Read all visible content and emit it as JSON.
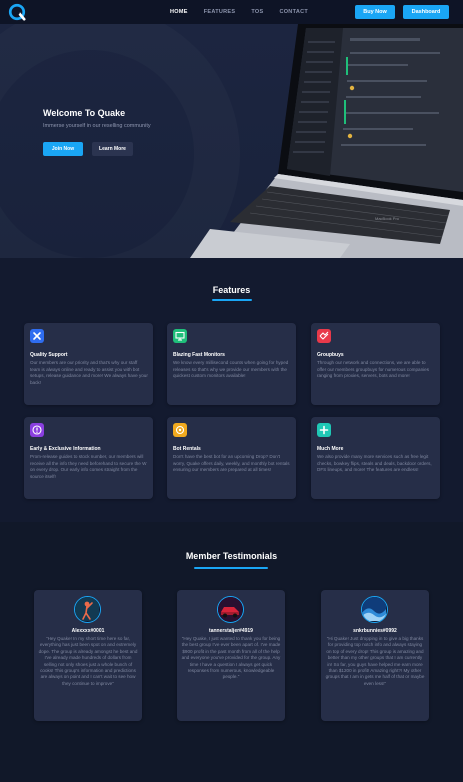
{
  "nav": {
    "links": [
      "HOME",
      "FEATURES",
      "TOS",
      "CONTACT"
    ],
    "buy_label": "Buy Now",
    "dashboard_label": "Dashboard"
  },
  "hero": {
    "title": "Welcome To Quake",
    "subtitle": "Immerse yourself in our reselling community",
    "join_label": "Join Now",
    "learn_label": "Learn More",
    "laptop_brand": "MacBook Pro"
  },
  "features": {
    "title": "Features",
    "cards": [
      {
        "icon": "tools-icon",
        "color": "#2f6df0",
        "title": "Quality Support",
        "text": "Our members are our priority and that's why our staff team is always online and ready to assist you with bot setups, release guidance and more! We always have your back!"
      },
      {
        "icon": "monitor-icon",
        "color": "#1fbf7a",
        "title": "Blazing Fast Monitors",
        "text": "We know every millisecond counts when going for hyped releases so that's why we provide our members with the quickest custom monitors available!"
      },
      {
        "icon": "handshake-icon",
        "color": "#e8394a",
        "title": "Groupbuys",
        "text": "Through our network and connections, we are able to offer our members groupbuys for numerous companies ranging from proxies, servers, bots and more!"
      },
      {
        "icon": "alert-icon",
        "color": "#8a3fe0",
        "title": "Early & Exclusive Information",
        "text": "Prom-release guides to stock number, our members will receive all the info they need beforehand to secure the W on every drop. Our early info comes straight from the source itself!"
      },
      {
        "icon": "coins-icon",
        "color": "#f0a91e",
        "title": "Bot Rentals",
        "text": "Don't have the best bot for an upcoming Drop? Don't worry, Quake offers daily, weekly, and monthly bot rentals ensuring our members are prepared at all times!"
      },
      {
        "icon": "plus-icon",
        "color": "#1fc7b5",
        "title": "Much More",
        "text": "We also provide many more services such as free legit checks, bowkey flips, steals and deals, backdoor orders, DFS lineups, and more! The features are endless!"
      }
    ]
  },
  "testimonials": {
    "title": "Member Testimonials",
    "items": [
      {
        "avatar": "golfer-avatar",
        "name": "Alexxxx#0001",
        "text": "\"Hey Quake! In my short time here so far, everything has just been spot on and extremely dope. The group is already amongst he best and I've already made hundreds of dollars from selling not only shoes just a whole bunch of cooks! This group's information and predictions are always on point and I can't wait to see how they continue to improve\""
      },
      {
        "avatar": "car-avatar",
        "name": "tannerstaljer#4919",
        "text": "\"Hey Quake, I just wanted to thank you for being the best group I've ever been apart of. I've made $900 profit in the past month from all of the help and everyone you've provided for the group. Any time I have a question I always get quick responses from numerous, knowledgeable people.\""
      },
      {
        "avatar": "wave-avatar",
        "name": "snkrbunnies#0992",
        "text": "\"Hi Quake! Just dropping in to give a big thanks for providing top notch info and always staying on top of every drop! This group is amazing and better than my other groups that I am currently in! So far, you guys have helped me earn more than $1200 in profit! Amazing right?! My other groups that I am in gets me half of that or maybe even less!\""
      }
    ]
  }
}
